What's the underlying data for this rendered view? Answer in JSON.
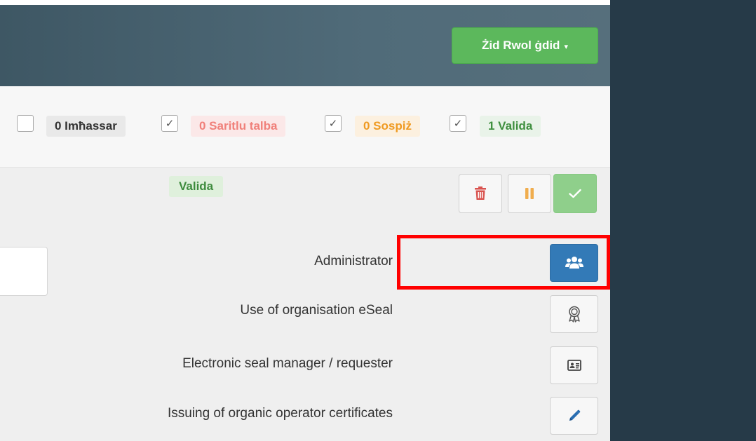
{
  "header": {
    "add_role_label": "Żid Rwol ġdid",
    "add_role_caret": "▾",
    "accent": "#5cb85c"
  },
  "filters": {
    "pending": {
      "label": "0 Imħassar",
      "checked": false
    },
    "rejected": {
      "label": "0 Saritlu talba",
      "checked": true,
      "color": "#f0807a"
    },
    "suspended": {
      "label": "0 Sospiż",
      "checked": true,
      "color": "#ef9a22"
    },
    "valid": {
      "label": "1 Valida",
      "checked": true,
      "color": "#3f8f3f"
    },
    "check_glyph": "✓"
  },
  "status": {
    "badge": "Valida"
  },
  "actions": [
    {
      "name": "delete",
      "icon": "trash-icon",
      "color": "#d9534f"
    },
    {
      "name": "suspend",
      "icon": "pause-icon",
      "color": "#f0ad4e"
    },
    {
      "name": "approve",
      "icon": "check-icon",
      "color": "#5cb85c"
    }
  ],
  "roles": [
    {
      "label": "Administrator",
      "icon": "users-icon",
      "active": true
    },
    {
      "label": "Use of organisation eSeal",
      "icon": "award-icon",
      "active": false
    },
    {
      "label": "Electronic seal manager / requester",
      "icon": "id-card-icon",
      "active": false
    },
    {
      "label": "Issuing of organic operator certificates",
      "icon": "pencil-icon",
      "active": false
    }
  ],
  "highlight_color": "#ff0000"
}
